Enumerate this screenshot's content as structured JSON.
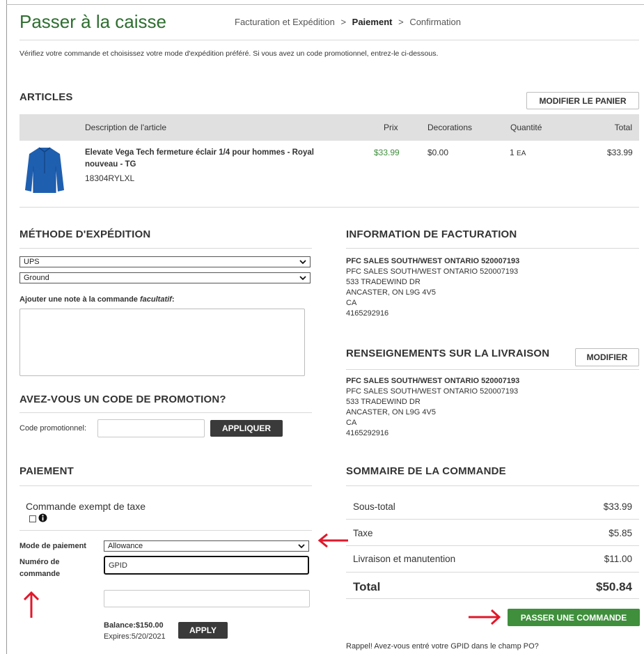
{
  "header": {
    "title": "Passer à la caisse",
    "steps": [
      "Facturation et Expédition",
      "Paiement",
      "Confirmation"
    ],
    "separator": ">",
    "active_step": "Paiement"
  },
  "intro": "Vérifiez votre commande et choisissez votre mode d'expédition préféré. Si vous avez un code promotionnel, entrez-le ci-dessous.",
  "articles": {
    "title": "ARTICLES",
    "edit_cart_label": "MODIFIER LE PANIER",
    "columns": {
      "description": "Description de l'article",
      "price": "Prix",
      "decorations": "Decorations",
      "quantity": "Quantité",
      "total": "Total"
    },
    "item": {
      "name_line1": "Elevate Vega Tech fermeture éclair 1/4 pour hommes - Royal",
      "name_line2": "nouveau - TG",
      "sku": "18304RYLXL",
      "price": "$33.99",
      "decorations": "$0.00",
      "quantity": "1",
      "unit": "EA",
      "total": "$33.99",
      "image_icon": "jacket-image",
      "color": "#1f5fb0"
    }
  },
  "shipping": {
    "title": "MÉTHODE D'EXPÉDITION",
    "carrier": "UPS",
    "service": "Ground",
    "note_label": "Ajouter une note à la commande",
    "note_optional": "facultatif",
    "note_colon": ":"
  },
  "billing": {
    "title": "INFORMATION DE FACTURATION",
    "lines": [
      "PFC SALES SOUTH/WEST ONTARIO 520007193",
      "PFC SALES SOUTH/WEST ONTARIO 520007193",
      "533 TRADEWIND DR",
      "ANCASTER, ON L9G 4V5",
      "CA",
      "4165292916"
    ]
  },
  "delivery": {
    "title": "RENSEIGNEMENTS SUR LA LIVRAISON",
    "edit_label": "MODIFIER",
    "lines": [
      "PFC SALES SOUTH/WEST ONTARIO 520007193",
      "PFC SALES SOUTH/WEST ONTARIO 520007193",
      "533 TRADEWIND DR",
      "ANCASTER, ON L9G 4V5",
      "CA",
      "4165292916"
    ]
  },
  "promo": {
    "title": "AVEZ-VOUS UN CODE DE PROMOTION?",
    "label": "Code promotionnel:",
    "value": "",
    "apply_label": "APPLIQUER"
  },
  "payment": {
    "title": "PAIEMENT",
    "tax_exempt_label": "Commande exempt de taxe",
    "method_label": "Mode de paiement",
    "method_value": "Allowance",
    "po_label_line1": "Numéro de",
    "po_label_line2": "commande",
    "po_value": "GPID",
    "extra_value": "",
    "balance": "Balance:$150.00",
    "expires": "Expires:5/20/2021",
    "apply_label": "APPLY"
  },
  "summary": {
    "title": "SOMMAIRE DE LA COMMANDE",
    "rows": [
      {
        "label": "Sous-total",
        "value": "$33.99"
      },
      {
        "label": "Taxe",
        "value": "$5.85"
      },
      {
        "label": "Livraison et manutention",
        "value": "$11.00"
      }
    ],
    "total_label": "Total",
    "total_value": "$50.84",
    "place_order_label": "PASSER UNE COMMANDE",
    "reminder": "Rappel! Avez-vous entré votre GPID dans le champ PO?"
  },
  "colors": {
    "title_green": "#2d6e2f",
    "price_green": "#3f8f3c",
    "button_green": "#3f8f3c",
    "arrow_red": "#e0182b"
  }
}
